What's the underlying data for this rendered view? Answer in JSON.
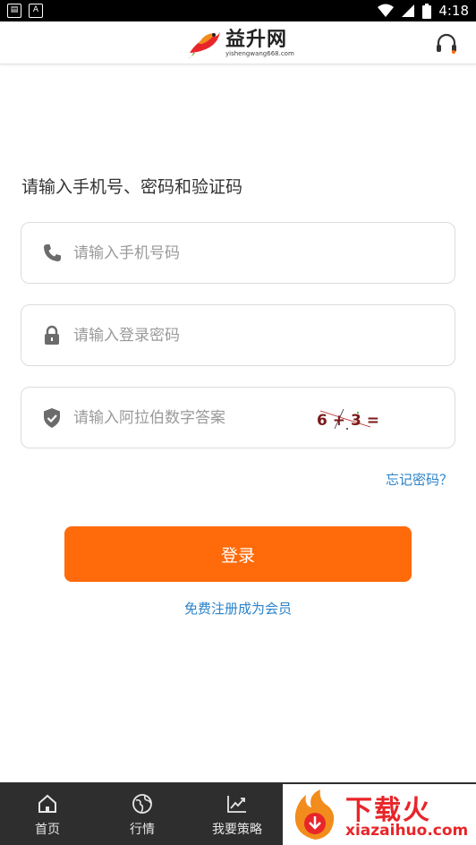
{
  "status_bar": {
    "time": "4:18",
    "left_icons": [
      "sim-icon",
      "a-icon"
    ],
    "right_icons": [
      "wifi-icon",
      "signal-icon",
      "battery-icon"
    ]
  },
  "header": {
    "logo_cn": "益升网",
    "logo_en": "yishengwang668.com",
    "support_icon": "headset-icon"
  },
  "form": {
    "prompt": "请输入手机号、密码和验证码",
    "phone": {
      "placeholder": "请输入手机号码",
      "value": "",
      "icon": "phone-icon"
    },
    "password": {
      "placeholder": "请输入登录密码",
      "value": "",
      "icon": "lock-icon"
    },
    "captcha": {
      "placeholder": "请输入阿拉伯数字答案",
      "value": "",
      "icon": "shield-icon",
      "image_text": "6 + 3 ="
    },
    "forgot_label": "忘记密码？",
    "login_label": "登录",
    "register_label": "免费注册成为会员"
  },
  "bottom_nav": {
    "items": [
      {
        "label": "首页",
        "icon": "home-icon"
      },
      {
        "label": "行情",
        "icon": "globe-icon"
      },
      {
        "label": "我要策略",
        "icon": "chart-icon"
      }
    ]
  },
  "watermark": {
    "title": "下载火",
    "subtitle": "xiazaihuo.com"
  },
  "colors": {
    "accent": "#ff6a0a",
    "link": "#2b82c9",
    "nav_bg": "#2e2e2e"
  }
}
